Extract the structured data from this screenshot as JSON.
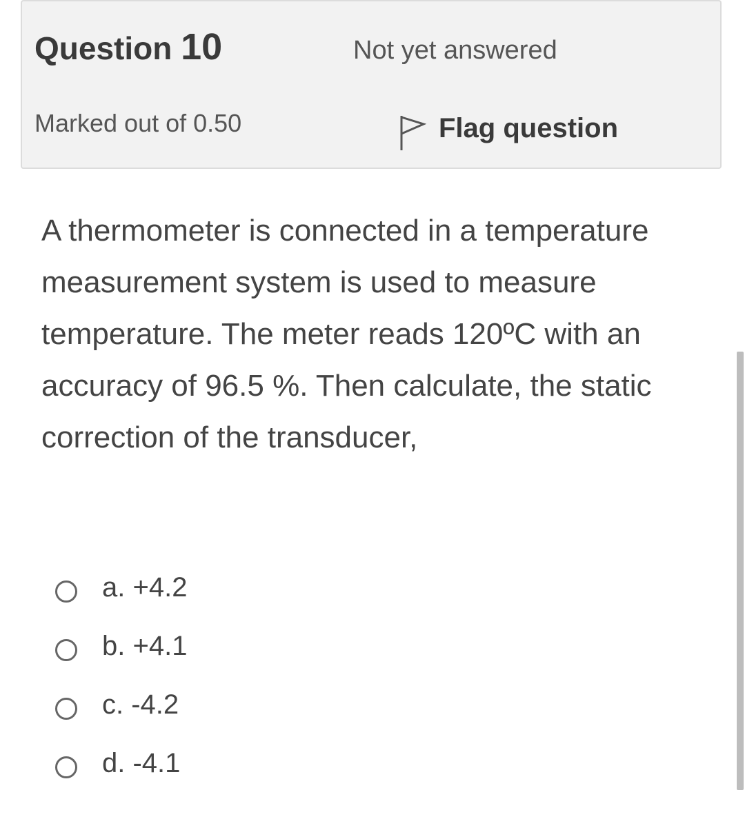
{
  "info": {
    "question_label": "Question",
    "question_number": "10",
    "state": "Not yet answered",
    "grade": "Marked out of 0.50",
    "flag_label": "Flag question",
    "flag_icon": "flag-outline-icon"
  },
  "question": {
    "text": "A thermometer is connected in a temperature measurement system is used to measure temperature. The meter reads 120ºC with an accuracy of 96.5 %. Then calculate, the static correction of the transducer,"
  },
  "answers": [
    {
      "label": "a. +4.2"
    },
    {
      "label": "b. +4.1"
    },
    {
      "label": "c. -4.2"
    },
    {
      "label": "d. -4.1"
    }
  ],
  "colors": {
    "info_background": "#f2f2f2",
    "info_border": "#dcdcdc",
    "text": "#444444",
    "scrollbar": "#bdbdbd"
  }
}
